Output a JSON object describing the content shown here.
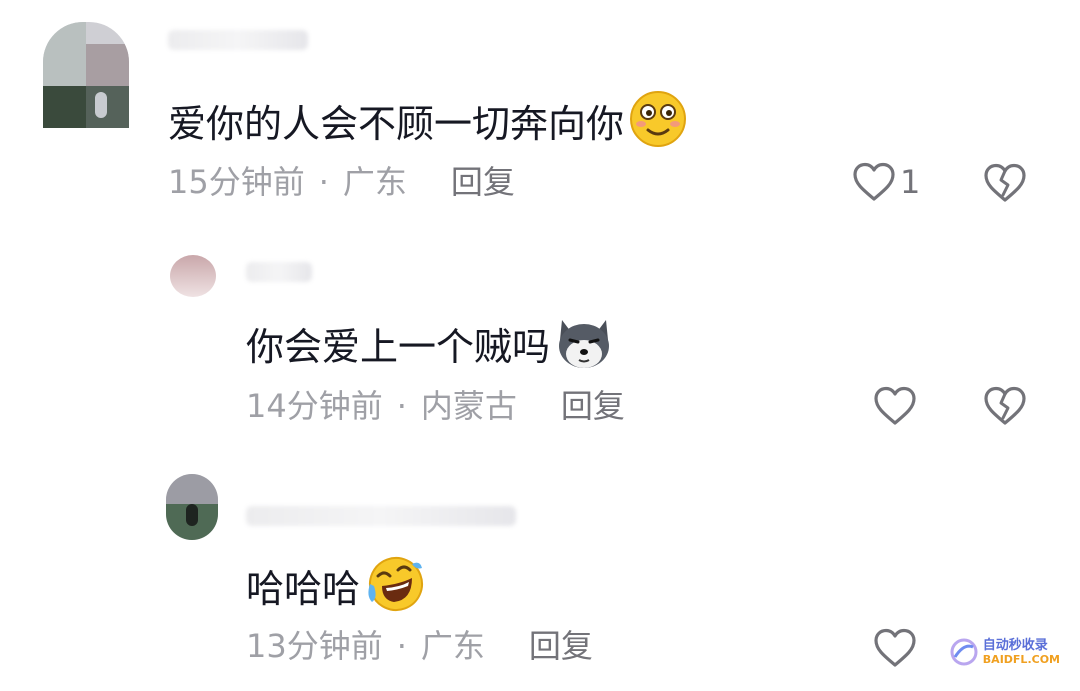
{
  "comments": [
    {
      "text": "爱你的人会不顾一切奔向你",
      "emoji": "smirk-emoji",
      "time": "15分钟前",
      "separator": "·",
      "location": "广东",
      "reply": "回复",
      "like_count": "1"
    },
    {
      "text": "你会爱上一个贼吗",
      "emoji": "husky-dog-emoji",
      "time": "14分钟前",
      "separator": "·",
      "location": "内蒙古",
      "reply": "回复",
      "like_count": ""
    },
    {
      "text": "哈哈哈",
      "emoji": "laughing-tears-emoji",
      "time": "13分钟前",
      "separator": "·",
      "location": "广东",
      "reply": "回复",
      "like_count": ""
    }
  ],
  "watermark": {
    "line1": "自动秒收录",
    "line2": "BAIDFL.COM"
  },
  "colors": {
    "text": "#161823",
    "meta": "#9fa0a6",
    "icon": "#737379"
  }
}
